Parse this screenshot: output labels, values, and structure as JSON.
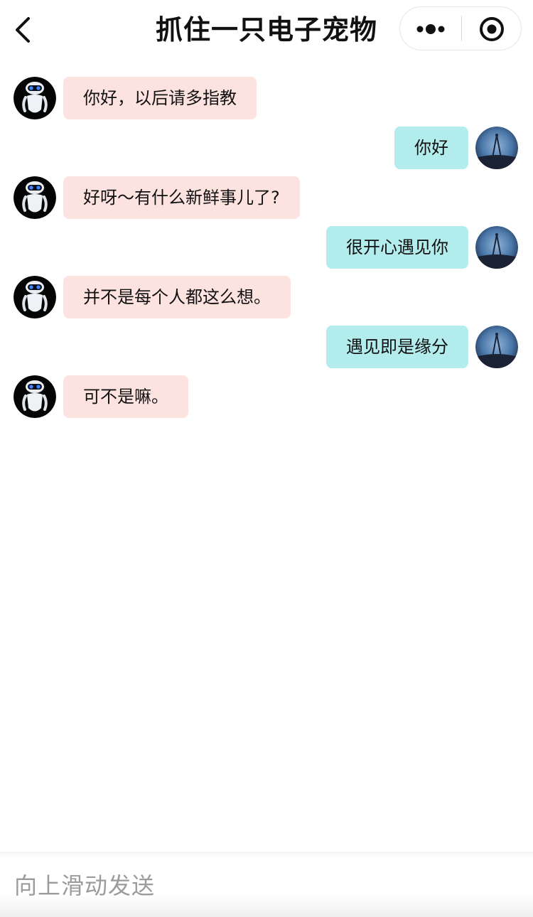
{
  "header": {
    "title": "抓住一只电子宠物",
    "back_icon": "chevron-left-icon",
    "more_icon": "more-dots-icon",
    "close_icon": "record-circle-icon"
  },
  "messages": [
    {
      "side": "bot",
      "text": "你好，以后请多指教"
    },
    {
      "side": "user",
      "text": "你好"
    },
    {
      "side": "bot",
      "text": "好呀～有什么新鲜事儿了?"
    },
    {
      "side": "user",
      "text": "很开心遇见你"
    },
    {
      "side": "bot",
      "text": "并不是每个人都这么想。"
    },
    {
      "side": "user",
      "text": "遇见即是缘分"
    },
    {
      "side": "bot",
      "text": "可不是嘛。"
    }
  ],
  "input": {
    "placeholder": "向上滑动发送"
  },
  "colors": {
    "bot_bubble": "#fde3df",
    "user_bubble": "#b2eced"
  }
}
